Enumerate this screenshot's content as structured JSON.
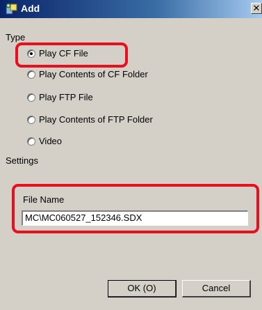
{
  "window": {
    "title": "Add",
    "close_glyph": "✕",
    "icon": "add-icon"
  },
  "type_group": {
    "label": "Type",
    "options": [
      {
        "label": "Play CF File",
        "selected": true
      },
      {
        "label": "Play Contents of CF Folder",
        "selected": false
      },
      {
        "label": "Play FTP File",
        "selected": false
      },
      {
        "label": "Play Contents of FTP Folder",
        "selected": false
      },
      {
        "label": "Video",
        "selected": false
      }
    ]
  },
  "settings": {
    "label": "Settings",
    "file_name_label": "File Name",
    "file_name_value": "MC\\MC060527_152346.SDX"
  },
  "buttons": {
    "ok": "OK (O)",
    "cancel": "Cancel"
  },
  "colors": {
    "highlight": "#e8101e",
    "dialog_bg": "#d4d0c8",
    "titlebar": "#0a246a"
  }
}
